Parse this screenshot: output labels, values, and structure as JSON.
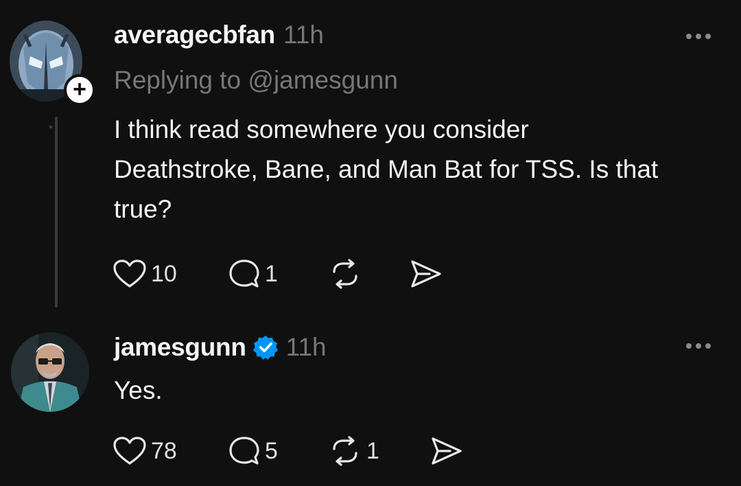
{
  "posts": [
    {
      "username": "averagecbfan",
      "time": "11h",
      "replying_to": "Replying to @jamesgunn",
      "text_lines": [
        "I think read somewhere you consider",
        "Deathstroke, Bane, and Man Bat for TSS. Is that",
        "true?"
      ],
      "follow_badge": "+",
      "likes": "10",
      "replies": "1",
      "reposts": "",
      "verified": false
    },
    {
      "username": "jamesgunn",
      "time": "11h",
      "text_lines": [
        "Yes."
      ],
      "likes": "78",
      "replies": "5",
      "reposts": "1",
      "verified": true
    }
  ],
  "icons": {
    "like": "heart-icon",
    "reply": "comment-bubble-icon",
    "repost": "repost-icon",
    "share": "send-icon",
    "more": "more-dots-icon",
    "verified": "verified-badge-icon"
  },
  "colors": {
    "background": "#101010",
    "text_primary": "#f3f5f7",
    "text_secondary": "#777777",
    "verified_blue": "#0095f6",
    "thread_line": "#3a3a3a"
  }
}
